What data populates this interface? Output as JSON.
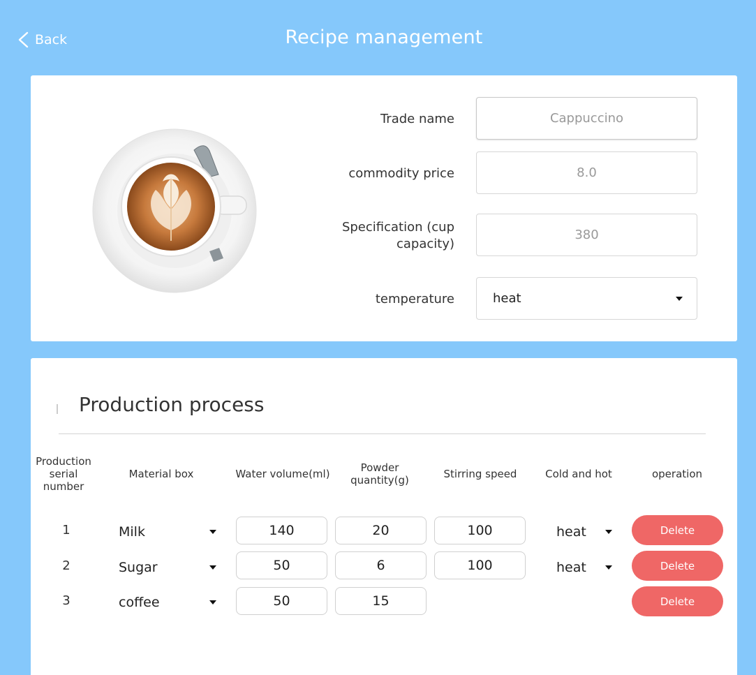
{
  "header": {
    "back_label": "Back",
    "title": "Recipe management"
  },
  "form": {
    "trade_name": {
      "label": "Trade name",
      "value": "Cappuccino"
    },
    "price": {
      "label": "commodity price",
      "value": "8.0"
    },
    "spec": {
      "label": "Specification (cup capacity)",
      "value": "380"
    },
    "temperature": {
      "label": "temperature",
      "value": "heat"
    }
  },
  "production": {
    "title": "Production process",
    "columns": [
      "Production serial number",
      "Material box",
      "Water volume(ml)",
      "Powder quantity(g)",
      "Stirring speed",
      "Cold and hot",
      "operation"
    ],
    "rows": [
      {
        "serial": "1",
        "material": "Milk",
        "water": "140",
        "powder": "20",
        "speed": "100",
        "temp": "heat",
        "action": "Delete"
      },
      {
        "serial": "2",
        "material": "Sugar",
        "water": "50",
        "powder": "6",
        "speed": "100",
        "temp": "heat",
        "action": "Delete"
      },
      {
        "serial": "3",
        "material": "coffee",
        "water": "50",
        "powder": "15",
        "speed": "",
        "temp": "",
        "action": "Delete"
      }
    ]
  },
  "colors": {
    "background": "#85c8fb",
    "delete_button": "#ef6766",
    "panel": "#ffffff"
  },
  "icons": {
    "back": "chevron-left-icon",
    "dropdown": "caret-down-icon"
  }
}
